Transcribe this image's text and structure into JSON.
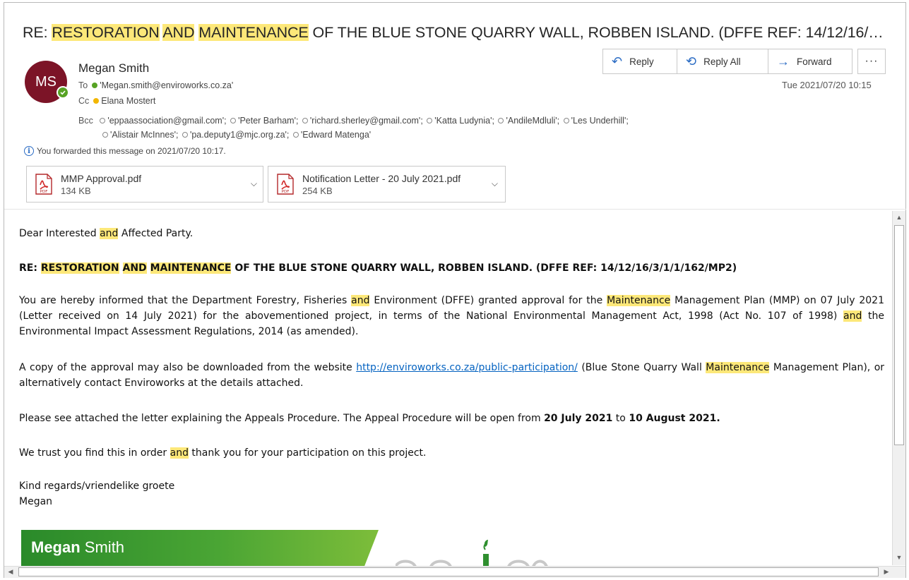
{
  "subject": {
    "prefix": "RE: ",
    "hl1": "RESTORATION",
    "hl2": "AND",
    "hl3": "MAINTENANCE",
    "rest": " OF THE BLUE STONE QUARRY WALL, ROBBEN ISLAND. (DFFE REF: 14/12/16/…"
  },
  "sender": {
    "initials": "MS",
    "name": "Megan Smith",
    "to_label": "To",
    "to": "'Megan.smith@enviroworks.co.za'",
    "cc_label": "Cc",
    "cc": "Elana Mostert",
    "bcc_label": "Bcc",
    "bcc_line1": [
      "'eppaassociation@gmail.com';",
      "'Peter Barham';",
      "'richard.sherley@gmail.com';",
      "'Katta Ludynia';",
      "'AndileMdluli';",
      "'Les Underhill';"
    ],
    "bcc_line2": [
      "'Alistair McInnes';",
      "'pa.deputy1@mjc.org.za';",
      "'Edward Matenga'"
    ]
  },
  "actions": {
    "reply": "Reply",
    "reply_all": "Reply All",
    "forward": "Forward",
    "more": "···"
  },
  "date": "Tue 2021/07/20 10:15",
  "info": "You forwarded this message on 2021/07/20 10:17.",
  "attachments": [
    {
      "name": "MMP Approval.pdf",
      "size": "134 KB",
      "icon_label": "PDF"
    },
    {
      "name": "Notification Letter - 20 July 2021.pdf",
      "size": "254 KB",
      "icon_label": "PDF"
    }
  ],
  "body": {
    "greeting_a": "Dear Interested ",
    "greeting_hl": "and",
    "greeting_b": " Affected Party.",
    "re_prefix": "RE: ",
    "re_hl1": "RESTORATION",
    "re_hl2": "AND",
    "re_hl3": "MAINTENANCE",
    "re_rest": " OF THE BLUE STONE QUARRY WALL, ROBBEN ISLAND. (DFFE REF: 14/12/16/3/1/1/162/MP2)",
    "p1_a": "You are hereby informed that the Department Forestry, Fisheries ",
    "p1_hl1": "and",
    "p1_b": " Environment (DFFE) granted approval for the ",
    "p1_hl2": "Maintenance",
    "p1_c": " Management Plan (MMP) on 07 July 2021 (Letter received on 14 July 2021) for the abovementioned project, in terms of the National Environmental Management Act, 1998 (Act No. 107 of 1998) ",
    "p1_hl3": "and",
    "p1_d": " the Environmental Impact Assessment Regulations, 2014 (as amended).",
    "p2_a": "A copy of the approval may also be downloaded from the website ",
    "p2_link": "http://enviroworks.co.za/public-participation/",
    "p2_b": " (Blue Stone Quarry Wall ",
    "p2_hl": "Maintenance",
    "p2_c": " Management Plan), or alternatively contact Enviroworks at the details attached.",
    "p3_a": "Please see attached the letter explaining the Appeals Procedure. The Appeal Procedure will be open from ",
    "p3_d1": "20 July 2021",
    "p3_b": " to ",
    "p3_d2": "10 August 2021.",
    "p4_a": "We trust you find this in order ",
    "p4_hl": "and",
    "p4_b": " thank you for your participation on this project.",
    "closing": "Kind regards/vriendelike groete",
    "signoff": "Megan"
  },
  "signature": {
    "first": "Megan",
    "last": " Smith"
  },
  "colors": {
    "highlight": "#fde879",
    "avatar": "#7c1427",
    "accent": "#2b6cc4",
    "link": "#0563c1"
  }
}
